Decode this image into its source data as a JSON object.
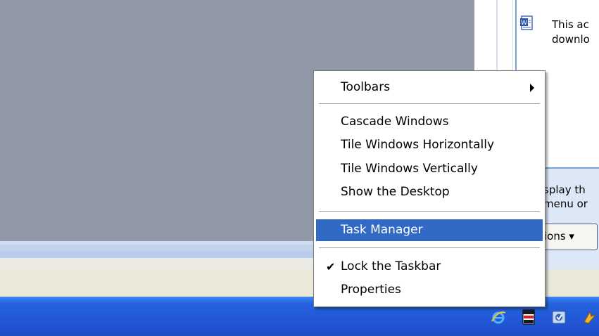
{
  "background_window": {
    "info_text_lines": [
      "This ac",
      "downlo"
    ],
    "lower_text_lines": [
      "splay th",
      "menu or"
    ],
    "options_button_label": "ions ▾"
  },
  "context_menu": {
    "items": [
      {
        "label": "Toolbars",
        "has_submenu": true
      },
      {
        "label": "Cascade Windows"
      },
      {
        "label": "Tile Windows Horizontally"
      },
      {
        "label": "Tile Windows Vertically"
      },
      {
        "label": "Show the Desktop"
      },
      {
        "label": "Task Manager",
        "highlighted": true
      },
      {
        "label": "Lock the Taskbar",
        "checked": true
      },
      {
        "label": "Properties"
      }
    ]
  },
  "taskbar": {
    "tray_icons": [
      "internet-explorer-icon",
      "flag-icon",
      "update-icon",
      "network-icon"
    ]
  },
  "colors": {
    "highlight": "#316ac5",
    "taskbar": "#2157d8",
    "desktop": "#9199a8"
  }
}
